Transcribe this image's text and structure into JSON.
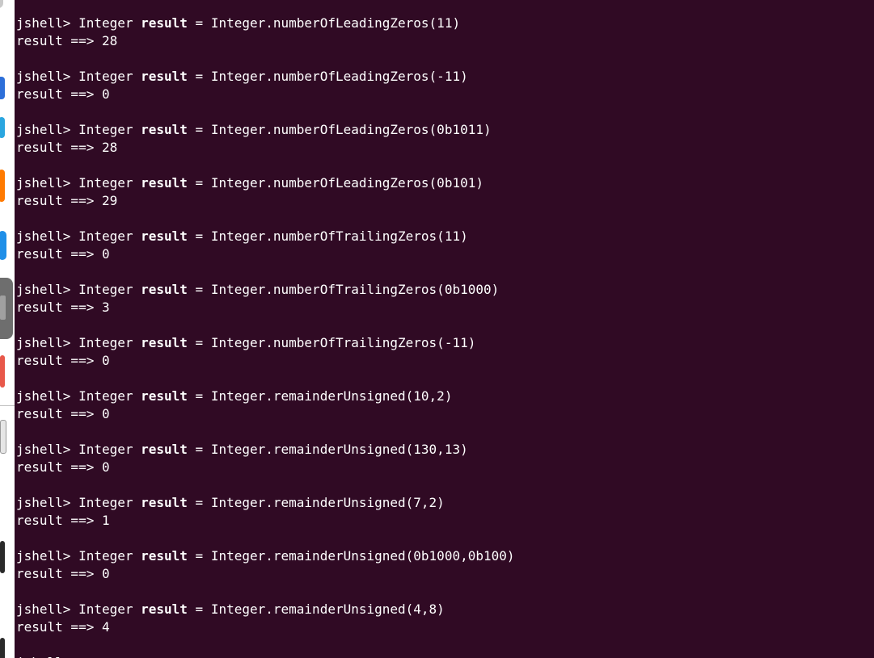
{
  "terminal": {
    "prompt": "jshell> ",
    "type_word": "Integer ",
    "var_name": "result",
    "assign": " = ",
    "result_prefix": "result ==> ",
    "entries": [
      {
        "call": "Integer.numberOfLeadingZeros(11)",
        "result": "28"
      },
      {
        "call": "Integer.numberOfLeadingZeros(-11)",
        "result": "0"
      },
      {
        "call": "Integer.numberOfLeadingZeros(0b1011)",
        "result": "28"
      },
      {
        "call": "Integer.numberOfLeadingZeros(0b101)",
        "result": "29"
      },
      {
        "call": "Integer.numberOfTrailingZeros(11)",
        "result": "0"
      },
      {
        "call": "Integer.numberOfTrailingZeros(0b1000)",
        "result": "3"
      },
      {
        "call": "Integer.numberOfTrailingZeros(-11)",
        "result": "0"
      },
      {
        "call": "Integer.remainderUnsigned(10,2)",
        "result": "0"
      },
      {
        "call": "Integer.remainderUnsigned(130,13)",
        "result": "0"
      },
      {
        "call": "Integer.remainderUnsigned(7,2)",
        "result": "1"
      },
      {
        "call": "Integer.remainderUnsigned(0b1000,0b100)",
        "result": "0"
      },
      {
        "call": "Integer.remainderUnsigned(4,8)",
        "result": "4"
      }
    ],
    "last_prompt": "jshell>"
  },
  "colors": {
    "background": "#300a24",
    "text": "#ffffff"
  }
}
